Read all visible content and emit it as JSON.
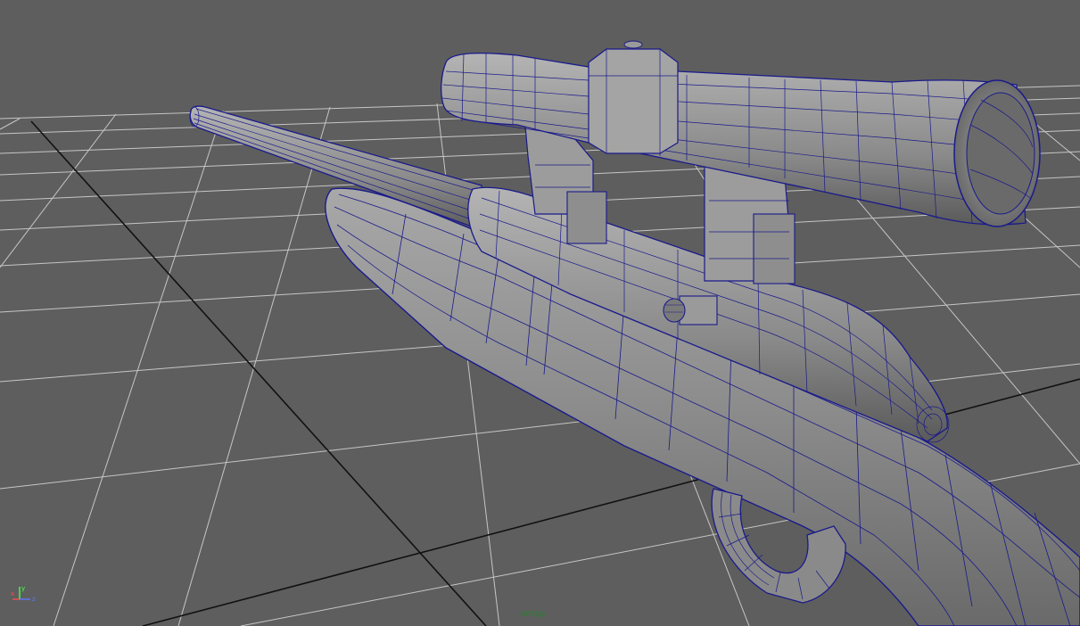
{
  "viewport": {
    "camera_label": "persp",
    "background_color": "#5e5e5e",
    "grid_color": "#c8c8c8",
    "grid_axis_color": "#111111",
    "wire_color": "#1a1a8c",
    "mesh_color": "#8a8a8a"
  },
  "axis_gizmo": {
    "x_label": "x",
    "y_label": "y",
    "z_label": "z",
    "x_color": "#ff4a4a",
    "y_color": "#4aff4a",
    "z_color": "#5a78ff"
  },
  "model": {
    "icon": "rifle-wireframe-icon"
  }
}
